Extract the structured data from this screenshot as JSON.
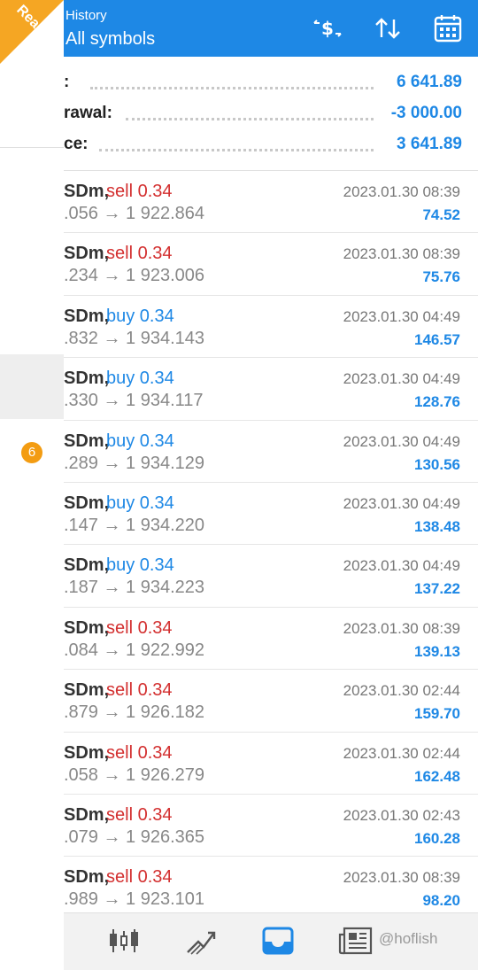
{
  "account": {
    "badge": "Real"
  },
  "header": {
    "subtitle": "History",
    "title": "All symbols",
    "icons": [
      "currency-exchange-icon",
      "sort-icon",
      "calendar-icon"
    ]
  },
  "summary": [
    {
      "label": ":",
      "value": "6 641.89"
    },
    {
      "label": "rawal:",
      "value": "-3 000.00"
    },
    {
      "label": "ce:",
      "value": "3 641.89"
    }
  ],
  "drawer": {
    "badge_count": "6"
  },
  "trades": [
    {
      "symbol": "SDm,",
      "side": "sell 0.34",
      "type": "sell",
      "prices": ".056 → 1 922.864",
      "time": "2023.01.30 08:39",
      "profit": "74.52"
    },
    {
      "symbol": "SDm,",
      "side": "sell 0.34",
      "type": "sell",
      "prices": ".234 → 1 923.006",
      "time": "2023.01.30 08:39",
      "profit": "75.76"
    },
    {
      "symbol": "SDm,",
      "side": "buy 0.34",
      "type": "buy",
      "prices": ".832 → 1 934.143",
      "time": "2023.01.30 04:49",
      "profit": "146.57"
    },
    {
      "symbol": "SDm,",
      "side": "buy 0.34",
      "type": "buy",
      "prices": ".330 → 1 934.117",
      "time": "2023.01.30 04:49",
      "profit": "128.76"
    },
    {
      "symbol": "SDm,",
      "side": "buy 0.34",
      "type": "buy",
      "prices": ".289 → 1 934.129",
      "time": "2023.01.30 04:49",
      "profit": "130.56"
    },
    {
      "symbol": "SDm,",
      "side": "buy 0.34",
      "type": "buy",
      "prices": ".147 → 1 934.220",
      "time": "2023.01.30 04:49",
      "profit": "138.48"
    },
    {
      "symbol": "SDm,",
      "side": "buy 0.34",
      "type": "buy",
      "prices": ".187 → 1 934.223",
      "time": "2023.01.30 04:49",
      "profit": "137.22"
    },
    {
      "symbol": "SDm,",
      "side": "sell 0.34",
      "type": "sell",
      "prices": ".084 → 1 922.992",
      "time": "2023.01.30 08:39",
      "profit": "139.13"
    },
    {
      "symbol": "SDm,",
      "side": "sell 0.34",
      "type": "sell",
      "prices": ".879 → 1 926.182",
      "time": "2023.01.30 02:44",
      "profit": "159.70"
    },
    {
      "symbol": "SDm,",
      "side": "sell 0.34",
      "type": "sell",
      "prices": ".058 → 1 926.279",
      "time": "2023.01.30 02:44",
      "profit": "162.48"
    },
    {
      "symbol": "SDm,",
      "side": "sell 0.34",
      "type": "sell",
      "prices": ".079 → 1 926.365",
      "time": "2023.01.30 02:43",
      "profit": "160.28"
    },
    {
      "symbol": "SDm,",
      "side": "sell 0.34",
      "type": "sell",
      "prices": ".989 → 1 923.101",
      "time": "2023.01.30 08:39",
      "profit": "98.20"
    }
  ],
  "bottom_nav": [
    {
      "name": "quotes-candles-icon"
    },
    {
      "name": "chart-trend-icon"
    },
    {
      "name": "history-inbox-icon",
      "active": true
    },
    {
      "name": "news-icon"
    }
  ],
  "watermark": "@hoflish",
  "colors": {
    "accent": "#1e88e5",
    "sell": "#d32f2f",
    "badge": "#f39c12",
    "ribbon": "#f5a623"
  }
}
